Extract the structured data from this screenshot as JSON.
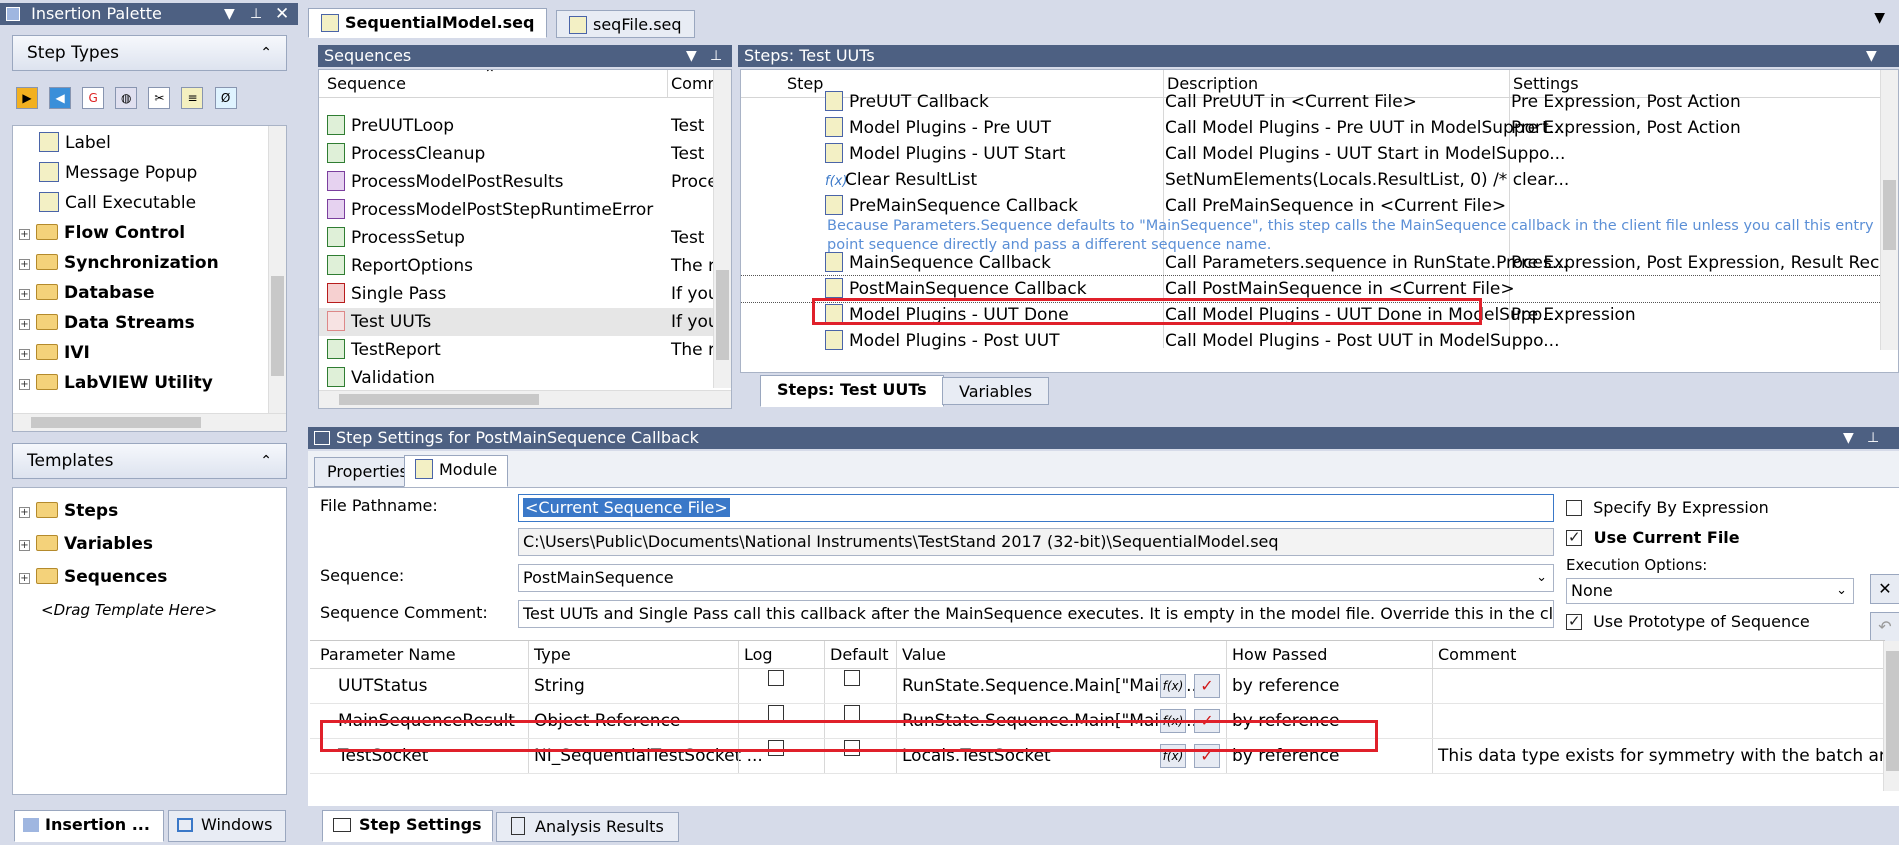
{
  "insertion_palette": {
    "title": "Insertion Palette",
    "step_types_label": "Step Types",
    "tree": [
      {
        "label": "Label",
        "bold": false,
        "icon": "label-icon"
      },
      {
        "label": "Message Popup",
        "bold": false,
        "icon": "message-popup-icon"
      },
      {
        "label": "Call Executable",
        "bold": false,
        "icon": "call-executable-icon"
      },
      {
        "label": "Flow Control",
        "bold": true,
        "icon": "folder-icon"
      },
      {
        "label": "Synchronization",
        "bold": true,
        "icon": "folder-icon"
      },
      {
        "label": "Database",
        "bold": true,
        "icon": "folder-icon"
      },
      {
        "label": "Data Streams",
        "bold": true,
        "icon": "folder-icon"
      },
      {
        "label": "IVI",
        "bold": true,
        "icon": "folder-icon"
      },
      {
        "label": "LabVIEW Utility",
        "bold": true,
        "icon": "folder-icon"
      }
    ],
    "templates_label": "Templates",
    "templates_tree": [
      {
        "label": "Steps"
      },
      {
        "label": "Variables"
      },
      {
        "label": "Sequences"
      }
    ],
    "drag_template": "<Drag Template Here>",
    "bottom_tabs": [
      "Insertion ...",
      "Windows"
    ]
  },
  "file_tabs": [
    "SequentialModel.seq",
    "seqFile.seq"
  ],
  "sequences": {
    "title": "Sequences",
    "col_sequence": "Sequence",
    "col_comment": "Comr",
    "rows": [
      {
        "name": "PreUUTLoop",
        "comment": "Test",
        "kind": "green"
      },
      {
        "name": "ProcessCleanup",
        "comment": "Test",
        "kind": "green"
      },
      {
        "name": "ProcessModelPostResults",
        "comment": "Proce",
        "kind": "purple"
      },
      {
        "name": "ProcessModelPostStepRuntimeError",
        "comment": "",
        "kind": "purple"
      },
      {
        "name": "ProcessSetup",
        "comment": "Test",
        "kind": "green"
      },
      {
        "name": "ReportOptions",
        "comment": "The r",
        "kind": "green"
      },
      {
        "name": "Single Pass",
        "comment": "If you",
        "kind": "red"
      },
      {
        "name": "Test UUTs",
        "comment": "If you",
        "kind": "pink"
      },
      {
        "name": "TestReport",
        "comment": "The r",
        "kind": "green"
      },
      {
        "name": "Validation",
        "comment": "",
        "kind": "green"
      }
    ]
  },
  "steps": {
    "title": "Steps: Test UUTs",
    "col_step": "Step",
    "col_description": "Description",
    "col_settings": "Settings",
    "rows": [
      {
        "step": "PreUUT Callback",
        "description": "Call PreUUT in <Current File>",
        "settings": "Pre Expression, Post Action"
      },
      {
        "step": "Model Plugins - Pre UUT",
        "description": "Call Model Plugins - Pre UUT in ModelSupport...",
        "settings": "Pre Expression, Post Action"
      },
      {
        "step": "Model Plugins - UUT Start",
        "description": "Call Model Plugins - UUT Start in ModelSuppo...",
        "settings": ""
      },
      {
        "step": "Clear ResultList",
        "description": "SetNumElements(Locals.ResultList, 0) /* clear...",
        "settings": ""
      },
      {
        "step": "PreMainSequence Callback",
        "description": "Call PreMainSequence in <Current File>",
        "settings": ""
      },
      {
        "step": "MainSequence Callback",
        "description": "Call Parameters.sequence in RunState.Proces...",
        "settings": "Pre Expression, Post Expression, Result Recordin..."
      },
      {
        "step": "PostMainSequence Callback",
        "description": "Call PostMainSequence in <Current File>",
        "settings": ""
      },
      {
        "step": "Model Plugins - UUT Done",
        "description": "Call Model Plugins - UUT Done in ModelSupp...",
        "settings": "Pre Expression"
      },
      {
        "step": "Model Plugins - Post UUT",
        "description": "Call Model Plugins - Post UUT in ModelSuppo...",
        "settings": ""
      }
    ],
    "comment_line1": "Because Parameters.Sequence defaults to \"MainSequence\", this step calls the MainSequence callback in the client file unless you call this entry",
    "comment_line2": "point sequence directly and pass a different sequence name.",
    "tabs": [
      "Steps: Test UUTs",
      "Variables"
    ]
  },
  "step_settings": {
    "title": "Step Settings for PostMainSequence Callback",
    "tabs": [
      "Properties",
      "Module"
    ],
    "file_pathname_label": "File Pathname:",
    "file_pathname_value": "<Current Sequence File>",
    "file_path_full": "C:\\Users\\Public\\Documents\\National Instruments\\TestStand 2017 (32-bit)\\SequentialModel.seq",
    "sequence_label": "Sequence:",
    "sequence_value": "PostMainSequence",
    "sequence_comment_label": "Sequence Comment:",
    "sequence_comment_value": "Test UUTs and Single Pass call this callback after the MainSequence executes. It is empty in the model file.  Override this in the client file to perfo",
    "specify_by_expression": "Specify By Expression",
    "use_current_file": "Use Current File",
    "execution_options_label": "Execution Options:",
    "execution_options_value": "None",
    "use_prototype": "Use Prototype of Sequence",
    "param_headers": [
      "Parameter Name",
      "Type",
      "Log",
      "Default",
      "Value",
      "How Passed",
      "Comment"
    ],
    "params": [
      {
        "name": "UUTStatus",
        "type": "String",
        "value": "RunState.Sequence.Main[\"MainS...",
        "how": "by reference",
        "comment": ""
      },
      {
        "name": "MainSequenceResult",
        "type": "Object Reference",
        "value": "RunState.Sequence.Main[\"MainS...",
        "how": "by reference",
        "comment": ""
      },
      {
        "name": "TestSocket",
        "type": "NI_SequentialTestSocket ...",
        "value": "Locals.TestSocket",
        "how": "by reference",
        "comment": "This data type exists for symmetry with the batch and para..."
      }
    ],
    "fx_label": "f(x)",
    "bottom_tabs": [
      "Step Settings",
      "Analysis Results"
    ]
  },
  "colors": {
    "title_bar": "#4d6082",
    "highlight_red": "#e0202a",
    "comment_blue": "#5b8fd6"
  }
}
